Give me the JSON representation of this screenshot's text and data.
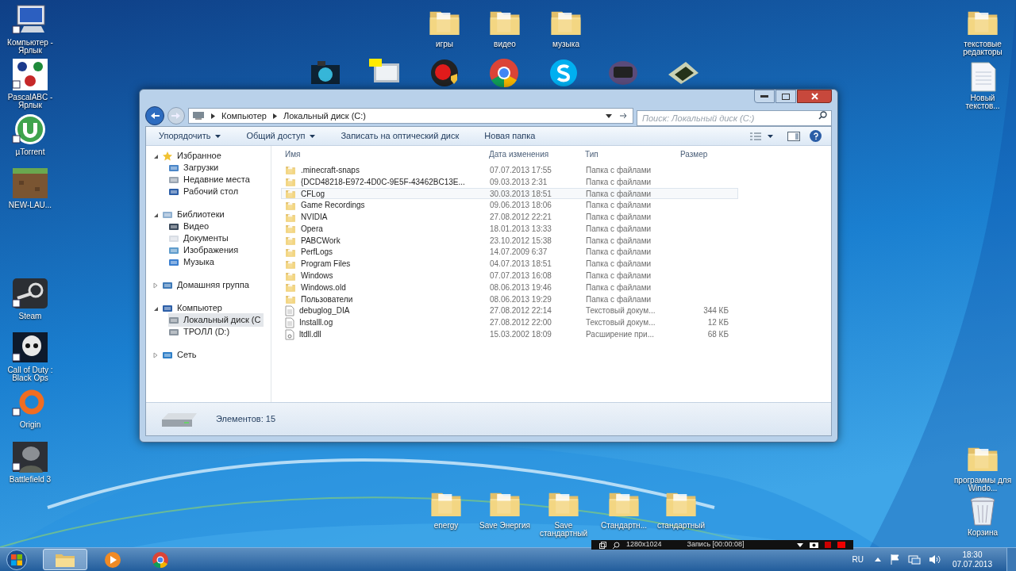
{
  "desktop_icons": [
    {
      "label": "Компьютер - Ярлык",
      "kind": "computer"
    },
    {
      "label": "PascalABC - Ярлык",
      "kind": "abc"
    },
    {
      "label": "µTorrent",
      "kind": "torrent"
    },
    {
      "label": "NEW-LAU...",
      "kind": "block"
    },
    {
      "label": "Steam",
      "kind": "steam"
    },
    {
      "label": "Call of Duty : Black Ops",
      "kind": "skull"
    },
    {
      "label": "Origin",
      "kind": "origin"
    },
    {
      "label": "Battlefield 3",
      "kind": "soldier"
    },
    {
      "label": "игры",
      "kind": "folder"
    },
    {
      "label": "видео",
      "kind": "folder"
    },
    {
      "label": "музыка",
      "kind": "folder"
    },
    {
      "label": "текстовые редакторы",
      "kind": "folder"
    },
    {
      "label": "Новый текстов...",
      "kind": "document"
    },
    {
      "label": "программы для Windo...",
      "kind": "folder"
    },
    {
      "label": "energy",
      "kind": "folder"
    },
    {
      "label": "Save Энергия",
      "kind": "folder"
    },
    {
      "label": "Save стандартный",
      "kind": "folder"
    },
    {
      "label": "Стандартн...",
      "kind": "folder"
    },
    {
      "label": "стандартный",
      "kind": "folder"
    },
    {
      "label": "Корзина",
      "kind": "bin"
    }
  ],
  "window": {
    "breadcrumb": [
      "Компьютер",
      "Локальный диск (C:)"
    ],
    "search": {
      "placeholder": "Поиск: Локальный диск (C:)"
    },
    "toolbar": [
      {
        "label": "Упорядочить",
        "dropdown": true
      },
      {
        "label": "Общий доступ",
        "dropdown": true
      },
      {
        "label": "Записать на оптический диск",
        "dropdown": false
      },
      {
        "label": "Новая папка",
        "dropdown": false
      }
    ],
    "nav": [
      {
        "label": "Избранное",
        "expanded": true,
        "selected": false,
        "children": [
          {
            "label": "Загрузки",
            "selected": false
          },
          {
            "label": "Недавние места",
            "selected": false
          },
          {
            "label": "Рабочий стол",
            "selected": false
          }
        ]
      },
      {
        "label": "Библиотеки",
        "expanded": true,
        "selected": false,
        "children": [
          {
            "label": "Видео",
            "selected": false
          },
          {
            "label": "Документы",
            "selected": false
          },
          {
            "label": "Изображения",
            "selected": false
          },
          {
            "label": "Музыка",
            "selected": false
          }
        ]
      },
      {
        "label": "Домашняя группа",
        "expanded": false,
        "selected": false
      },
      {
        "label": "Компьютер",
        "expanded": true,
        "selected": false,
        "children": [
          {
            "label": "Локальный диск (C",
            "selected": true
          },
          {
            "label": "ТРОЛЛ (D:)",
            "selected": false
          }
        ]
      },
      {
        "label": "Сеть",
        "expanded": false,
        "selected": false
      }
    ],
    "columns": [
      "Имя",
      "Дата изменения",
      "Тип",
      "Размер"
    ],
    "rows": [
      {
        "name": ".minecraft-snaps",
        "date": "07.07.2013 17:55",
        "type": "Папка с файлами",
        "kind": "folder",
        "hovered": false
      },
      {
        "name": "{DCD48218-E972-4D0C-9E5F-43462BC13E...",
        "date": "09.03.2013 2:31",
        "type": "Папка с файлами",
        "kind": "folder",
        "hovered": false
      },
      {
        "name": "CFLog",
        "date": "30.03.2013 18:51",
        "type": "Папка с файлами",
        "kind": "folder",
        "hovered": true
      },
      {
        "name": "Game Recordings",
        "date": "09.06.2013 18:06",
        "type": "Папка с файлами",
        "kind": "folder",
        "hovered": false
      },
      {
        "name": "NVIDIA",
        "date": "27.08.2012 22:21",
        "type": "Папка с файлами",
        "kind": "folder",
        "hovered": false
      },
      {
        "name": "Opera",
        "date": "18.01.2013 13:33",
        "type": "Папка с файлами",
        "kind": "folder",
        "hovered": false
      },
      {
        "name": "PABCWork",
        "date": "23.10.2012 15:38",
        "type": "Папка с файлами",
        "kind": "folder",
        "hovered": false
      },
      {
        "name": "PerfLogs",
        "date": "14.07.2009 6:37",
        "type": "Папка с файлами",
        "kind": "folder",
        "hovered": false
      },
      {
        "name": "Program Files",
        "date": "04.07.2013 18:51",
        "type": "Папка с файлами",
        "kind": "folder",
        "hovered": false
      },
      {
        "name": "Windows",
        "date": "07.07.2013 16:08",
        "type": "Папка с файлами",
        "kind": "folder",
        "hovered": false
      },
      {
        "name": "Windows.old",
        "date": "08.06.2013 19:46",
        "type": "Папка с файлами",
        "kind": "folder",
        "hovered": false
      },
      {
        "name": "Пользователи",
        "date": "08.06.2013 19:29",
        "type": "Папка с файлами",
        "kind": "folder",
        "hovered": false
      },
      {
        "name": "debuglog_DIA",
        "date": "27.08.2012 22:14",
        "type": "Текстовый докум...",
        "size": "344 КБ",
        "kind": "text",
        "hovered": false
      },
      {
        "name": "Installl.og",
        "date": "27.08.2012 22:00",
        "type": "Текстовый докум...",
        "size": "12 КБ",
        "kind": "text",
        "hovered": false
      },
      {
        "name": "ltdll.dll",
        "date": "15.03.2002 18:09",
        "type": "Расширение при...",
        "size": "68 КБ",
        "kind": "dll",
        "hovered": false
      }
    ],
    "status": "Элементов: 15"
  },
  "recorder_bar": {
    "resolution": "1280x1024",
    "recording": "Запись [00:00:08]"
  },
  "taskbar": {
    "apps": [
      {
        "kind": "explorer",
        "selected": true
      },
      {
        "kind": "media",
        "selected": false
      },
      {
        "kind": "chrome",
        "selected": false
      }
    ],
    "language": "RU",
    "time": "18:30",
    "date": "07.07.2013"
  }
}
